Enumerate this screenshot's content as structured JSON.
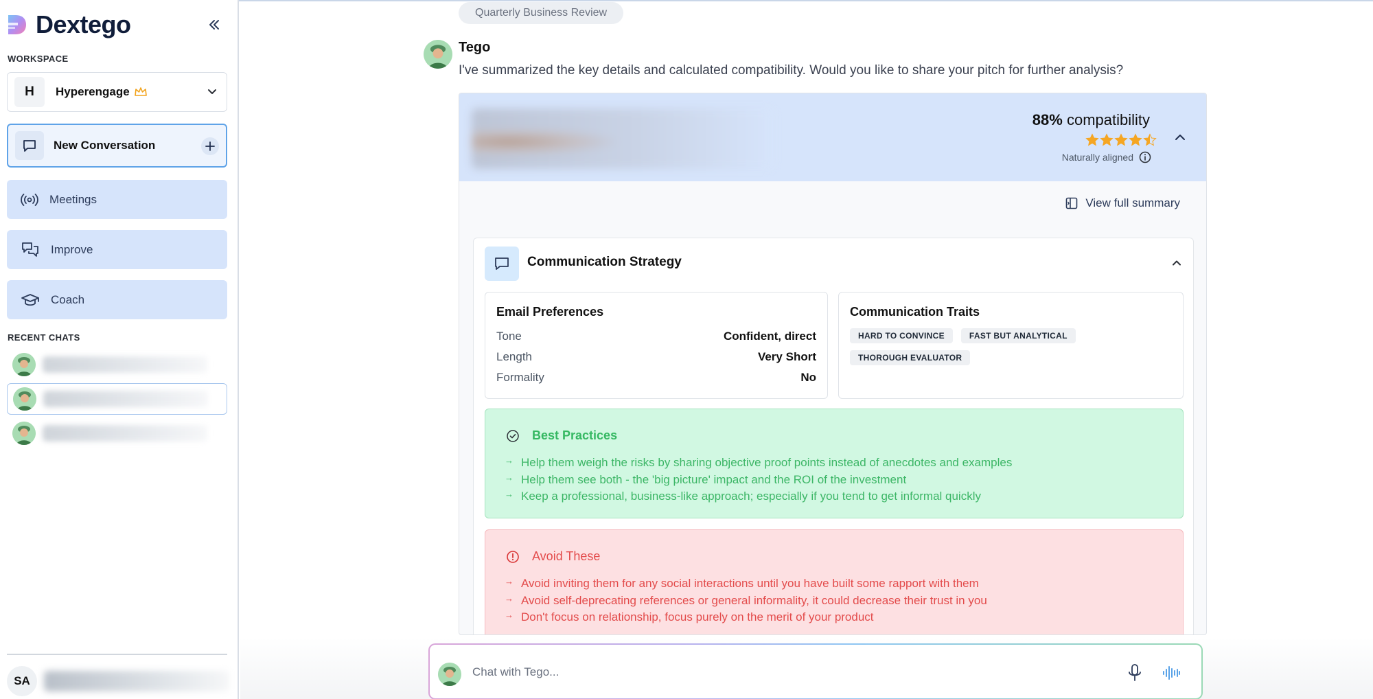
{
  "app": {
    "name": "Dextego"
  },
  "sidebar": {
    "workspace_label": "WORKSPACE",
    "workspace": {
      "initial": "H",
      "name": "Hyperengage"
    },
    "new_conversation": "New Conversation",
    "nav": [
      {
        "label": "Meetings",
        "icon": "broadcast-icon"
      },
      {
        "label": "Improve",
        "icon": "chat-bubbles-icon"
      },
      {
        "label": "Coach",
        "icon": "graduation-cap-icon"
      }
    ],
    "recent_label": "RECENT CHATS",
    "user": {
      "initials": "SA"
    }
  },
  "conversation": {
    "topic": "Quarterly Business Review",
    "sender": "Tego",
    "message": "I've summarized the key details and calculated compatibility. Would you like to share your pitch for further analysis?"
  },
  "summary": {
    "compat_value": "88%",
    "compat_label": "compatibility",
    "stars": 4.5,
    "alignment": "Naturally aligned",
    "view_full": "View full summary",
    "strategy_title": "Communication Strategy",
    "email_title": "Email Preferences",
    "prefs": [
      {
        "key": "Tone",
        "value": "Confident, direct"
      },
      {
        "key": "Length",
        "value": "Very Short"
      },
      {
        "key": "Formality",
        "value": "No"
      }
    ],
    "traits_title": "Communication Traits",
    "traits": [
      "HARD TO CONVINCE",
      "FAST BUT ANALYTICAL",
      "THOROUGH EVALUATOR"
    ],
    "best_title": "Best Practices",
    "best": [
      "Help them weigh the risks by sharing objective proof points instead of anecdotes and examples",
      "Help them see both - the 'big picture' impact and the ROI of the investment",
      "Keep a professional, business-like approach; especially if you tend to get informal quickly"
    ],
    "avoid_title": "Avoid These",
    "avoid": [
      "Avoid inviting them for any social interactions until you have built some rapport with them",
      "Avoid self-deprecating references or general informality, it could decrease their trust in you",
      "Don't focus on relationship, focus purely on the merit of your product"
    ]
  },
  "chat": {
    "placeholder": "Chat with Tego..."
  },
  "colors": {
    "accent": "#d6e4fb",
    "success": "#35b862",
    "danger": "#e34b4b",
    "star": "#f5a623"
  }
}
